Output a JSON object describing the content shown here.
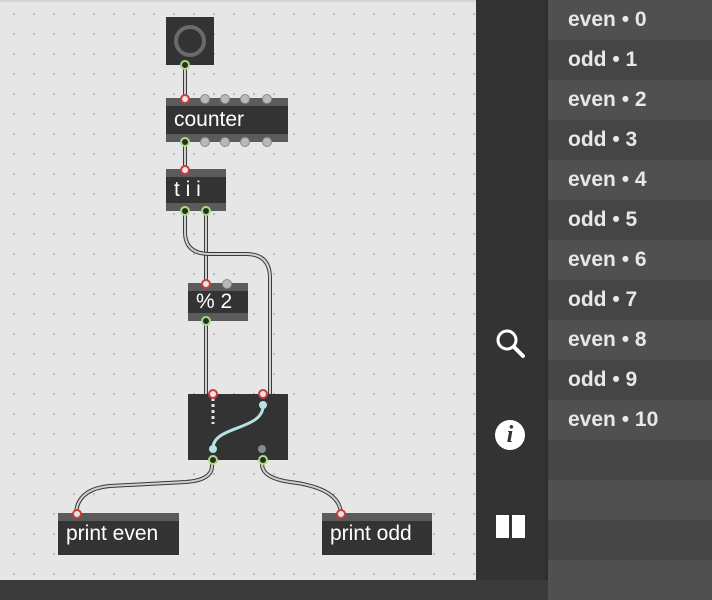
{
  "patcher": {
    "objects": {
      "counter": "counter",
      "trigger": "t i i",
      "modulo": "% 2",
      "print_even": "print even",
      "print_odd": "print odd"
    }
  },
  "toolbar": {
    "items": [
      {
        "name": "search",
        "icon": "search-icon"
      },
      {
        "name": "info",
        "icon": "info-icon"
      },
      {
        "name": "view",
        "icon": "columns-icon"
      }
    ]
  },
  "console": {
    "entries": [
      "even • 0",
      "odd • 1",
      "even • 2",
      "odd • 3",
      "even • 4",
      "odd • 5",
      "even • 6",
      "odd • 7",
      "even • 8",
      "odd • 9",
      "even • 10"
    ]
  },
  "colors": {
    "canvas": "#e6e6e6",
    "object": "#333333",
    "hot_inlet": "#cc3c3c",
    "outlet": "#a8e07a",
    "active_cord": "#b5e3e3",
    "console": "#454545"
  }
}
